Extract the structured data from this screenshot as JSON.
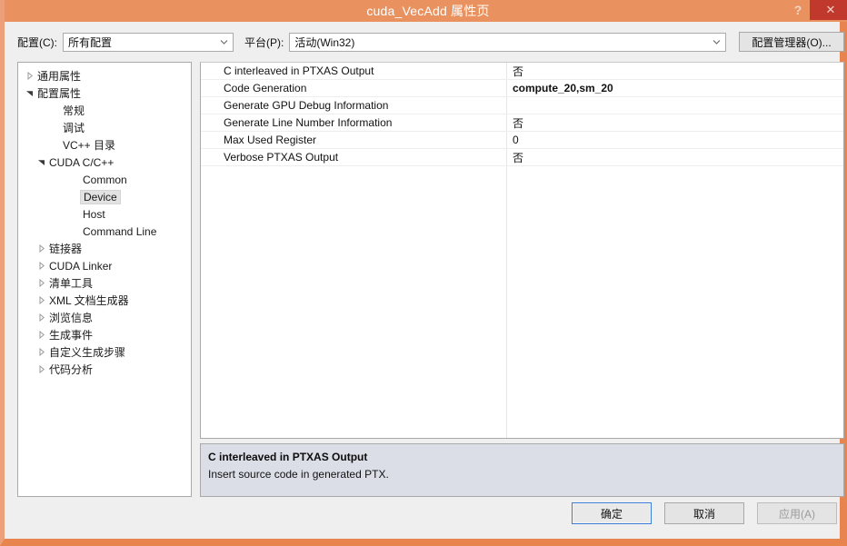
{
  "window": {
    "title": "cuda_VecAdd 属性页",
    "help_icon": "question-mark-icon",
    "close_icon": "✕",
    "accent_color": "#e9915f",
    "close_color": "#c1392d"
  },
  "toolbar": {
    "config_label": "配置(C):",
    "config_value": "所有配置",
    "platform_label": "平台(P):",
    "platform_value": "活动(Win32)",
    "config_manager_label": "配置管理器(O)..."
  },
  "tree": {
    "items": [
      {
        "label": "通用属性",
        "level": 0,
        "arrow": "collapsed",
        "selected": false
      },
      {
        "label": "配置属性",
        "level": 0,
        "arrow": "expanded",
        "selected": false
      },
      {
        "label": "常规",
        "level": 2,
        "arrow": "none",
        "selected": false
      },
      {
        "label": "调试",
        "level": 2,
        "arrow": "none",
        "selected": false
      },
      {
        "label": "VC++ 目录",
        "level": 2,
        "arrow": "none",
        "selected": false
      },
      {
        "label": "CUDA C/C++",
        "level": 1,
        "arrow": "expanded",
        "selected": false
      },
      {
        "label": "Common",
        "level": 3,
        "arrow": "none",
        "selected": false
      },
      {
        "label": "Device",
        "level": 3,
        "arrow": "none",
        "selected": true
      },
      {
        "label": "Host",
        "level": 3,
        "arrow": "none",
        "selected": false
      },
      {
        "label": "Command Line",
        "level": 3,
        "arrow": "none",
        "selected": false
      },
      {
        "label": "链接器",
        "level": 1,
        "arrow": "collapsed",
        "selected": false
      },
      {
        "label": "CUDA Linker",
        "level": 1,
        "arrow": "collapsed",
        "selected": false
      },
      {
        "label": "清单工具",
        "level": 1,
        "arrow": "collapsed",
        "selected": false
      },
      {
        "label": "XML 文档生成器",
        "level": 1,
        "arrow": "collapsed",
        "selected": false
      },
      {
        "label": "浏览信息",
        "level": 1,
        "arrow": "collapsed",
        "selected": false
      },
      {
        "label": "生成事件",
        "level": 1,
        "arrow": "collapsed",
        "selected": false
      },
      {
        "label": "自定义生成步骤",
        "level": 1,
        "arrow": "collapsed",
        "selected": false
      },
      {
        "label": "代码分析",
        "level": 1,
        "arrow": "collapsed",
        "selected": false
      }
    ]
  },
  "property_grid": {
    "rows": [
      {
        "name": "C interleaved in PTXAS Output",
        "value": "否",
        "bold": false
      },
      {
        "name": "Code Generation",
        "value": "compute_20,sm_20",
        "bold": true
      },
      {
        "name": "Generate GPU Debug Information",
        "value": "",
        "bold": false
      },
      {
        "name": "Generate Line Number Information",
        "value": "否",
        "bold": false
      },
      {
        "name": "Max Used Register",
        "value": "0",
        "bold": false
      },
      {
        "name": "Verbose PTXAS Output",
        "value": "否",
        "bold": false
      }
    ]
  },
  "description": {
    "title": "C interleaved in PTXAS Output",
    "body": "Insert source code in generated PTX."
  },
  "footer": {
    "ok_label": "确定",
    "cancel_label": "取消",
    "apply_label": "应用(A)"
  }
}
